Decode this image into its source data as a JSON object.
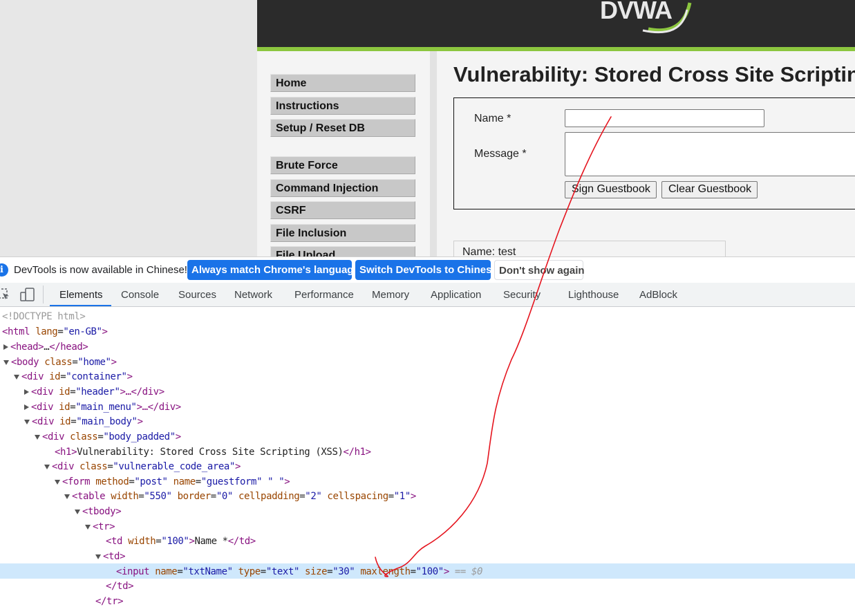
{
  "page": {
    "logo_text": "DVWA",
    "header_color": "#2b2b2b",
    "accent_color": "#8cc63f",
    "menu": {
      "group1": [
        "Home",
        "Instructions",
        "Setup / Reset DB"
      ],
      "group2": [
        "Brute Force",
        "Command Injection",
        "CSRF",
        "File Inclusion",
        "File Upload"
      ]
    },
    "title": "Vulnerability: Stored Cross Site Scripting (XSS)",
    "form": {
      "name_label": "Name *",
      "message_label": "Message *",
      "name_value": "",
      "message_value": "",
      "sign_button": "Sign Guestbook",
      "clear_button": "Clear Guestbook"
    },
    "entry_text": "Name: test"
  },
  "devtools": {
    "infobar": {
      "icon": "info-icon",
      "text": "DevTools is now available in Chinese!",
      "btn_match": "Always match Chrome's language",
      "btn_switch": "Switch DevTools to Chinese",
      "btn_dismiss": "Don't show again"
    },
    "tabs": [
      "Elements",
      "Console",
      "Sources",
      "Network",
      "Performance",
      "Memory",
      "Application",
      "Security",
      "Lighthouse",
      "AdBlock"
    ],
    "active_tab": "Elements",
    "tree": {
      "doctype": "<!DOCTYPE html>",
      "l1_tag": "html",
      "l1_attr": "lang",
      "l1_val": "\"en-GB\"",
      "l2_tag": "head",
      "l2_ellipsis": "…",
      "l2_close": "</head>",
      "l3_tag": "body",
      "l3_attr": "class",
      "l3_val": "\"home\"",
      "l4_tag": "div",
      "l4_attr": "id",
      "l4_val": "\"container\"",
      "l5_tag": "div",
      "l5_attr": "id",
      "l5_val": "\"header\"",
      "l5_rest": "…</div>",
      "l6_tag": "div",
      "l6_attr": "id",
      "l6_val": "\"main_menu\"",
      "l6_rest": "…</div>",
      "l7_tag": "div",
      "l7_attr": "id",
      "l7_val": "\"main_body\"",
      "l8_tag": "div",
      "l8_attr": "class",
      "l8_val": "\"body_padded\"",
      "l9_open": "<h1>",
      "l9_text": "Vulnerability: Stored Cross Site Scripting (XSS)",
      "l9_close": "</h1>",
      "l10_tag": "div",
      "l10_attr": "class",
      "l10_val": "\"vulnerable_code_area\"",
      "l11_tag": "form",
      "l11_a1": "method",
      "l11_v1": "\"post\"",
      "l11_a2": "name",
      "l11_v2": "\"guestform\"",
      "l11_v3": "\" \"",
      "l12_tag": "table",
      "l12_a1": "width",
      "l12_v1": "\"550\"",
      "l12_a2": "border",
      "l12_v2": "\"0\"",
      "l12_a3": "cellpadding",
      "l12_v3": "\"2\"",
      "l12_a4": "cellspacing",
      "l12_v4": "\"1\"",
      "l13_tag": "tbody",
      "l14_tag": "tr",
      "l15_tag": "td",
      "l15_attr": "width",
      "l15_val": "\"100\"",
      "l15_text": "Name *",
      "l15_close": "</td>",
      "l16_tag": "td",
      "l17_tag": "input",
      "l17_a1": "name",
      "l17_v1": "\"txtName\"",
      "l17_a2": "type",
      "l17_v2": "\"text\"",
      "l17_a3": "size",
      "l17_v3": "\"30\"",
      "l17_a4": "maxlength",
      "l17_v4": "\"100\"",
      "l17_suffix": "== $0",
      "l18_close": "</td>",
      "l19_close": "</tr>"
    }
  }
}
